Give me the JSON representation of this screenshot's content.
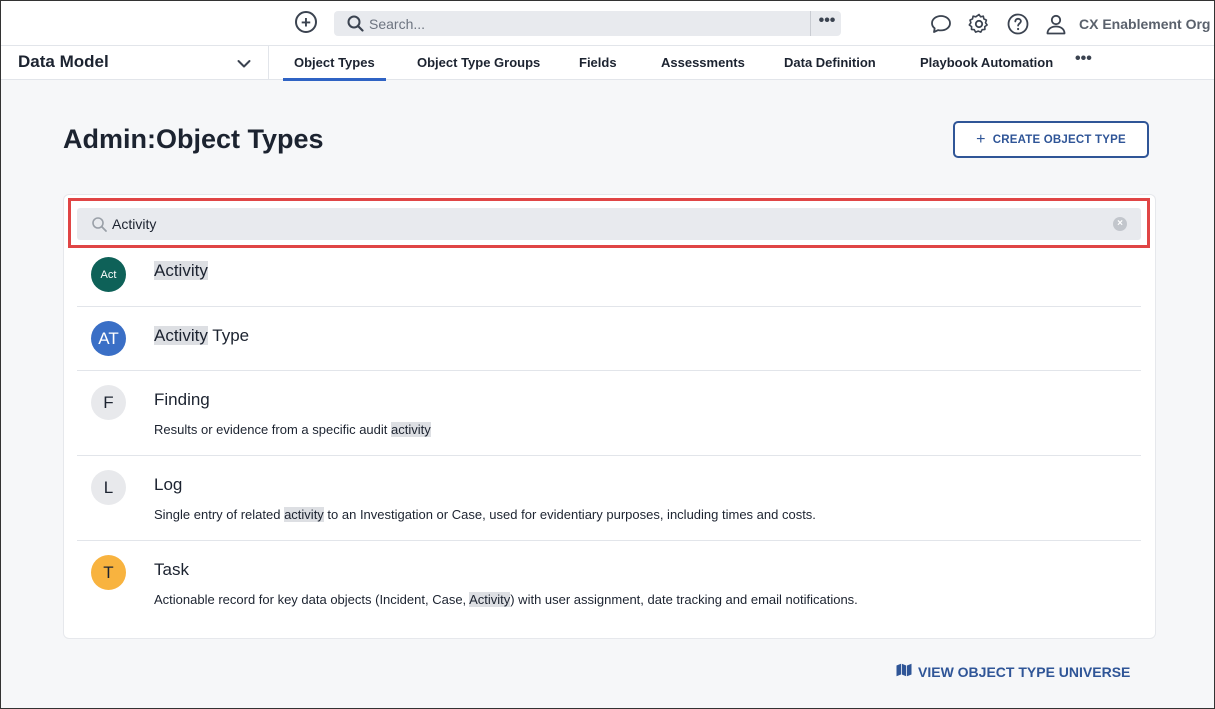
{
  "topbar": {
    "search_placeholder": "Search...",
    "more_label": "•••",
    "org_name": "CX Enablement Org"
  },
  "navbar": {
    "module": "Data Model",
    "tabs": [
      {
        "label": "Object Types",
        "active": true
      },
      {
        "label": "Object Type Groups",
        "active": false
      },
      {
        "label": "Fields",
        "active": false
      },
      {
        "label": "Assessments",
        "active": false
      },
      {
        "label": "Data Definition",
        "active": false
      },
      {
        "label": "Playbook Automation",
        "active": false
      }
    ],
    "more_label": "•••"
  },
  "page": {
    "title_prefix": "Admin",
    "title_sep": ":",
    "title": "Object Types",
    "create_button": "CREATE OBJECT TYPE"
  },
  "search": {
    "value": "Activity"
  },
  "items": [
    {
      "avatar": "Act",
      "color": "#0e6158",
      "name_pre": "",
      "name_hl": "Activity",
      "name_post": "",
      "desc_pre": "",
      "desc_hl": "",
      "desc_post": ""
    },
    {
      "avatar": "AT",
      "color": "#3a6fc6",
      "name_pre": "",
      "name_hl": "Activity",
      "name_post": " Type",
      "desc_pre": "",
      "desc_hl": "",
      "desc_post": ""
    },
    {
      "avatar": "F",
      "color": "#e8e9ec",
      "name_pre": "Finding",
      "name_hl": "",
      "name_post": "",
      "desc_pre": "Results or evidence from a specific audit ",
      "desc_hl": "activity",
      "desc_post": ""
    },
    {
      "avatar": "L",
      "color": "#e8e9ec",
      "name_pre": "Log",
      "name_hl": "",
      "name_post": "",
      "desc_pre": "Single entry of related ",
      "desc_hl": "activity",
      "desc_post": " to an Investigation or Case, used for evidentiary purposes, including times and costs."
    },
    {
      "avatar": "T",
      "color": "#f8b33f",
      "name_pre": "Task",
      "name_hl": "",
      "name_post": "",
      "desc_pre": "Actionable record for key data objects (Incident, Case, ",
      "desc_hl": "Activity",
      "desc_post": ") with user assignment, date tracking and email notifications."
    }
  ],
  "footer": {
    "universe_link": "VIEW OBJECT TYPE UNIVERSE"
  }
}
